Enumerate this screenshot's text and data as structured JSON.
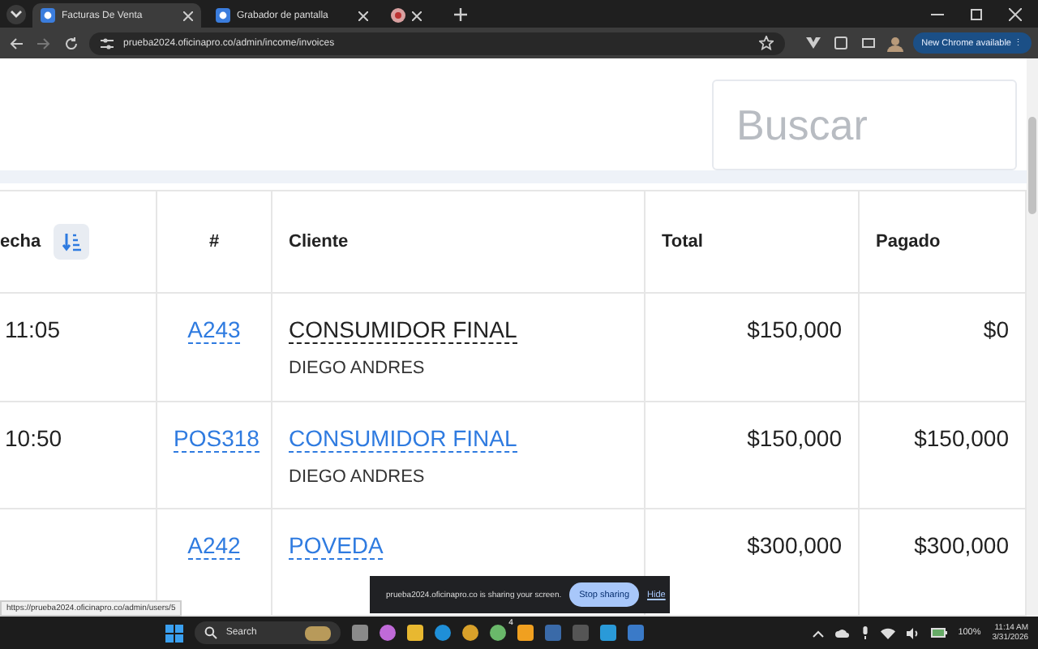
{
  "browser": {
    "tabs": [
      {
        "kind": "page",
        "title": "Facturas De Venta",
        "selected": true
      },
      {
        "kind": "page",
        "title": "Grabador de pantalla",
        "selected": false
      },
      {
        "kind": "recording",
        "selected": false
      }
    ],
    "url": "prueba2024.oficinapro.co/admin/income/invoices",
    "update_button": "New Chrome available",
    "menu_glyph": "⋮"
  },
  "page": {
    "search": {
      "placeholder": "Buscar"
    },
    "columns": [
      {
        "label": "echa",
        "sortable": true
      },
      {
        "label": "#",
        "sortable": false
      },
      {
        "label": "Cliente",
        "sortable": false
      },
      {
        "label": "Total",
        "sortable": false
      },
      {
        "label": "Pagado",
        "sortable": false
      }
    ],
    "rows": [
      {
        "time": "11:05",
        "number": "A243",
        "client": "CONSUMIDOR FINAL",
        "client_linked": false,
        "seller": "DIEGO ANDRES",
        "total": "$150,000",
        "paid": "$0"
      },
      {
        "time": "10:50",
        "number": "POS318",
        "client": "CONSUMIDOR FINAL",
        "client_linked": true,
        "seller": "DIEGO ANDRES",
        "total": "$150,000",
        "paid": "$150,000"
      },
      {
        "number": "A242",
        "client": "POVEDA",
        "client_linked": true,
        "total": "$300,000",
        "paid": "$300,000"
      }
    ]
  },
  "status_url": "https://prueba2024.oficinapro.co/admin/users/5",
  "share_bar": {
    "text": "prueba2024.oficinapro.co is sharing your screen.",
    "stop": "Stop sharing",
    "hide": "Hide"
  },
  "taskbar": {
    "search": "Search",
    "badge": "4",
    "battery": "100%",
    "time": "11:14 AM",
    "date": "3/31/2026"
  }
}
